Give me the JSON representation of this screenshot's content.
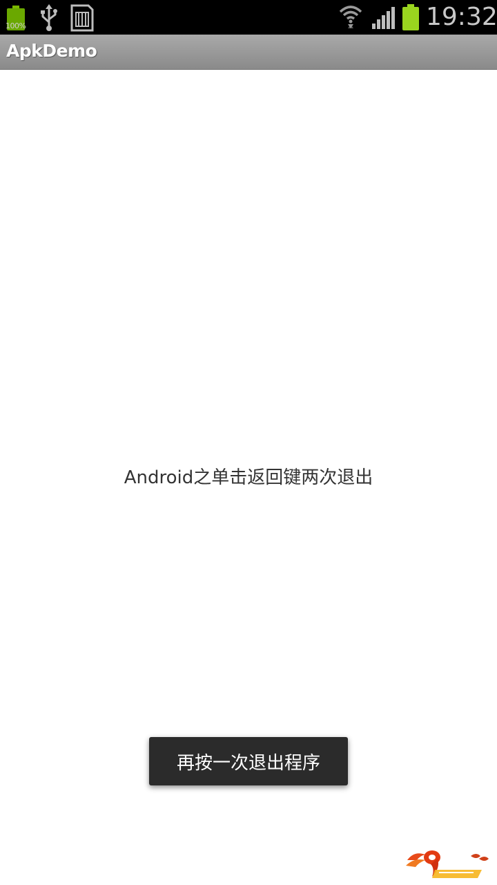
{
  "status_bar": {
    "battery_percent": "100%",
    "time": "19:32",
    "icons": [
      "battery-icon",
      "usb-icon",
      "sd-card-icon",
      "wifi-icon",
      "signal-icon",
      "battery-icon"
    ],
    "battery_color": "#7ab800"
  },
  "app": {
    "title": "ApkDemo"
  },
  "main": {
    "message": "Android之单击返回键两次退出"
  },
  "toast": {
    "text": "再按一次退出程序"
  },
  "watermark": {
    "logo": "9ria-logo"
  }
}
